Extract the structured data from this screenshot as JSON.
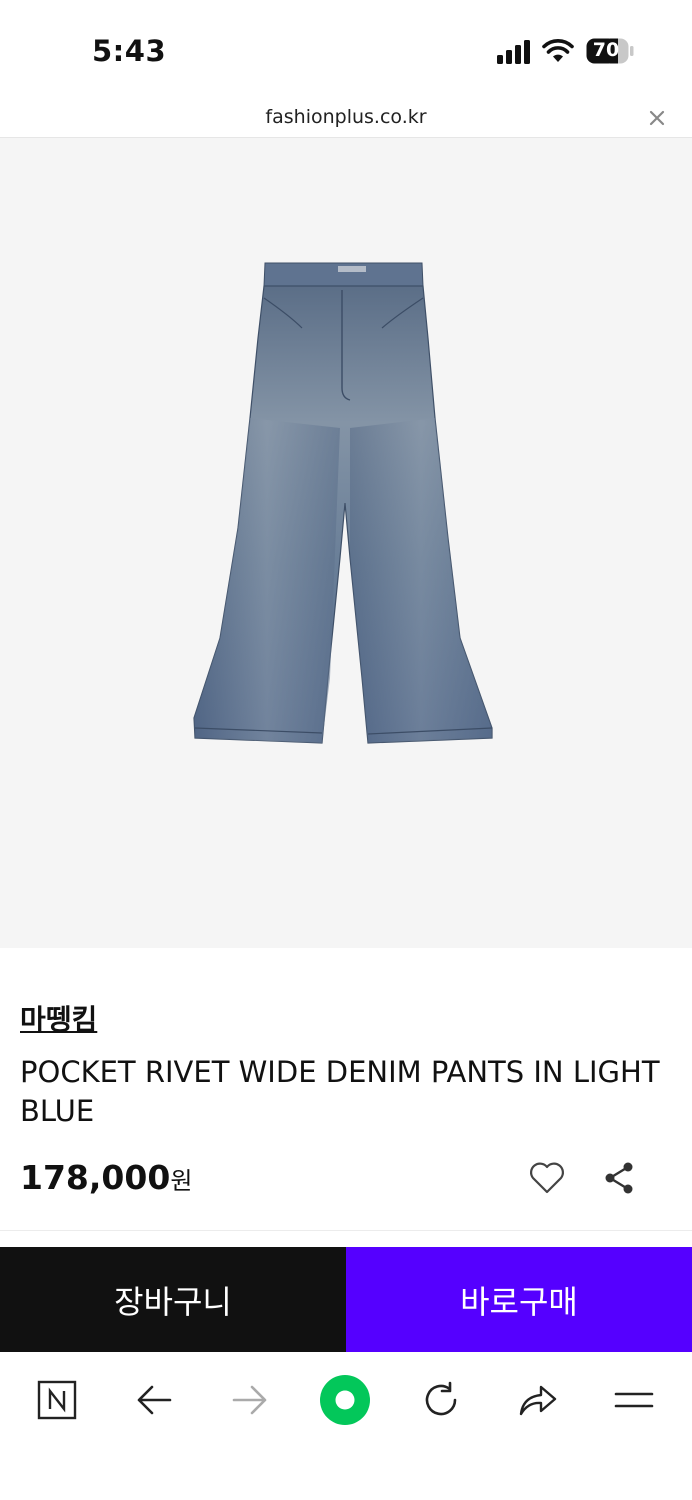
{
  "status": {
    "time": "5:43",
    "battery": "70"
  },
  "browser": {
    "url": "fashionplus.co.kr"
  },
  "product": {
    "brand": "마뗑킴",
    "name": "POCKET RIVET WIDE DENIM PANTS IN LIGHT BLUE",
    "price": "178,000",
    "currency": "원",
    "image_label": "jeans-photo"
  },
  "actions": {
    "cart_label": "장바구니",
    "buy_label": "바로구매"
  },
  "colors": {
    "buy": "#5500ff",
    "cart": "#111111",
    "naver_green": "#03c75a"
  },
  "toolbar": {
    "icons": [
      "naver-home-icon",
      "back-arrow-icon",
      "forward-arrow-icon",
      "green-dot-icon",
      "refresh-icon",
      "share-arrow-icon",
      "menu-icon"
    ]
  }
}
